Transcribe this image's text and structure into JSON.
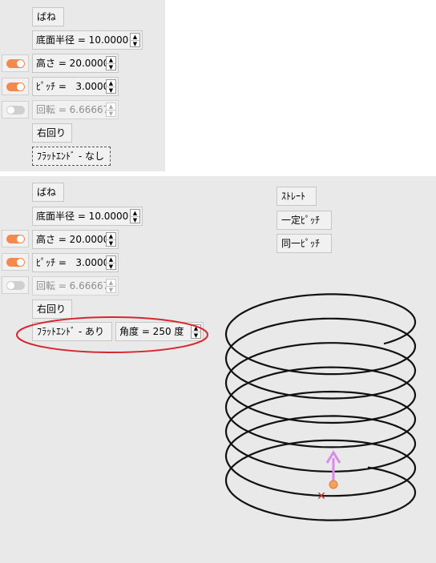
{
  "top_panel": {
    "title_button": "ばね",
    "radius": "底面半径 = 10.0000",
    "height": "高さ = 20.0000",
    "pitch": "ﾋﾟｯﾁ =   3.0000",
    "rotation": "回転 = 6.66667",
    "direction_button": "右回り",
    "flat_end_button": "ﾌﾗｯﾄｴﾝﾄﾞ - なし",
    "height_toggle": "on",
    "pitch_toggle": "on",
    "rotation_toggle": "off"
  },
  "bottom_panel": {
    "title_button": "ばね",
    "radius": "底面半径 = 10.0000",
    "height": "高さ = 20.0000",
    "pitch": "ﾋﾟｯﾁ =   3.0000",
    "rotation": "回転 = 6.66667",
    "direction_button": "右回り",
    "flat_end_button": "ﾌﾗｯﾄｴﾝﾄﾞ - あり",
    "angle": "角度 = 250 度",
    "height_toggle": "on",
    "pitch_toggle": "on",
    "rotation_toggle": "off",
    "straight_button": "ｽﾄﾚｰﾄ",
    "constant_pitch_button": "一定ﾋﾟｯﾁ",
    "same_pitch_button": "同一ﾋﾟｯﾁ"
  },
  "colors": {
    "panel_bg": "#e9e9e9",
    "toggle_on": "#f28a50",
    "toggle_off": "#cfcfcf",
    "highlight_ellipse": "#d7262e",
    "axis_arrow": "#d98ae8",
    "origin_marker": "#c0341d"
  },
  "icons": {
    "up_arrow": "▲",
    "down_arrow": "▼"
  }
}
